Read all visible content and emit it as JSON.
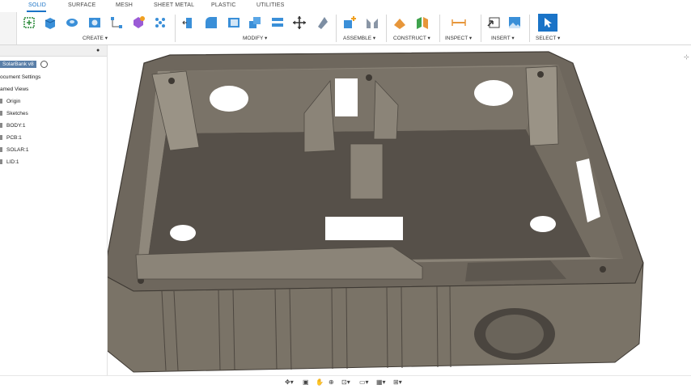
{
  "tabs": [
    "SOLID",
    "SURFACE",
    "MESH",
    "SHEET METAL",
    "PLASTIC",
    "UTILITIES"
  ],
  "groups": [
    "CREATE ▾",
    "MODIFY ▾",
    "ASSEMBLE ▾",
    "CONSTRUCT ▾",
    "INSPECT ▾",
    "INSERT ▾",
    "SELECT ▾"
  ],
  "browser": {
    "root": "SolarBank v8",
    "items": [
      "ocument Settings",
      "amed Views",
      "Origin",
      "Sketches",
      "BODY:1",
      "PCB:1",
      "SOLAR:1",
      "LID:1"
    ]
  },
  "colors": {
    "accent": "#1a73c7",
    "model": "#6e675d",
    "model_dark": "#4f4a43",
    "model_floor": "#5b554e"
  },
  "icons": [
    "sketch-icon",
    "extrude-icon",
    "revolve-icon",
    "hole-icon",
    "box-icon",
    "form-icon",
    "pattern-icon",
    "press-pull-icon",
    "fillet-icon",
    "shell-icon",
    "combine-icon",
    "move-icon",
    "align-icon",
    "new-component-icon",
    "joint-icon",
    "offset-plane-icon",
    "axis-icon",
    "measure-icon",
    "insert-mesh-icon",
    "decal-icon",
    "select-arrow-icon"
  ]
}
